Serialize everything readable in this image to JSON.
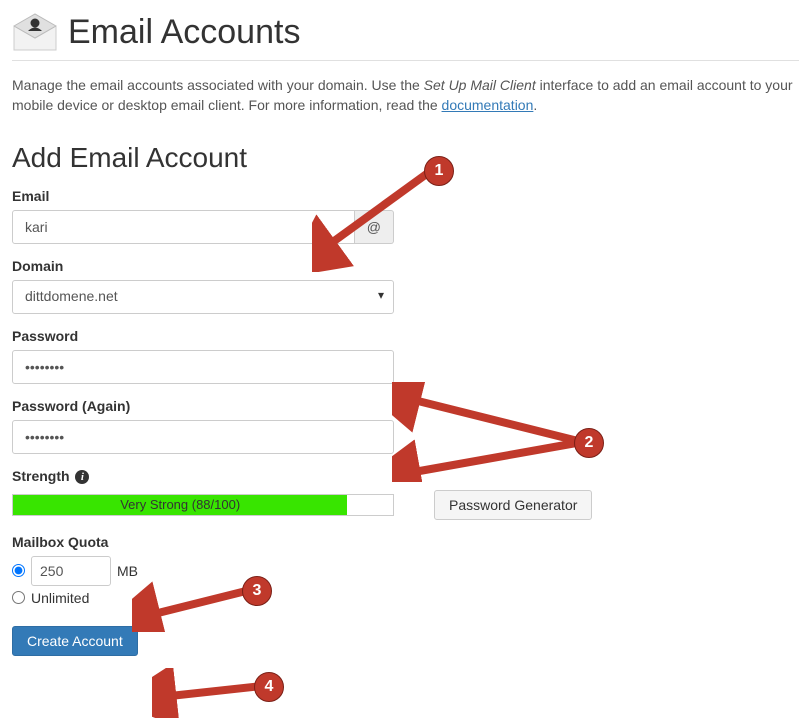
{
  "header": {
    "title": "Email Accounts",
    "intro_prefix": "Manage the email accounts associated with your domain. Use the ",
    "intro_em": "Set Up Mail Client",
    "intro_mid": " interface to add an email account to your mobile device or desktop email client. For more information, read the ",
    "intro_link": "documentation",
    "intro_suffix": "."
  },
  "form": {
    "section_title": "Add Email Account",
    "email_label": "Email",
    "email_value": "kari",
    "at_symbol": "@",
    "domain_label": "Domain",
    "domain_value": "dittdomene.net",
    "password_label": "Password",
    "password_value": "••••••••",
    "password2_label": "Password (Again)",
    "password2_value": "••••••••",
    "strength_label": "Strength",
    "strength_text": "Very Strong (88/100)",
    "strength_percent": 88,
    "password_generator_btn": "Password Generator",
    "quota_label": "Mailbox Quota",
    "quota_value": "250",
    "quota_unit": "MB",
    "quota_unlimited": "Unlimited",
    "submit_label": "Create Account"
  },
  "colors": {
    "primary": "#337ab7",
    "strength_bar": "#38e500",
    "callout": "#c0392b"
  },
  "annotations": {
    "n1": "1",
    "n2": "2",
    "n3": "3",
    "n4": "4"
  }
}
